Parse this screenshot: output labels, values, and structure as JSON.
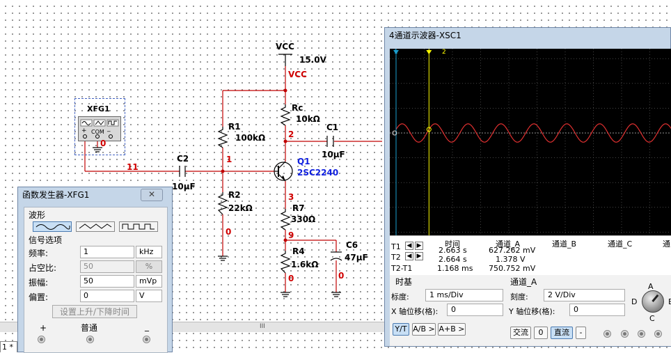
{
  "schematic": {
    "vcc_label": "VCC",
    "vcc_value": "15.0V",
    "vcc_net": "VCC",
    "xfg_label": "XFG1",
    "xfg_com": "COM",
    "xfg_plus": "+",
    "xfg_minus": "_",
    "node_xfg_minus": "0",
    "node_11": "11",
    "node_1": "1",
    "node_2": "2",
    "node_3": "3",
    "node_9": "9",
    "node_0a": "0",
    "node_0b": "0",
    "node_0c": "0",
    "r1_name": "R1",
    "r1_value": "100kΩ",
    "r2_name": "R2",
    "r2_value": "22kΩ",
    "rc_name": "Rc",
    "rc_value": "10kΩ",
    "r7_name": "R7",
    "r7_value": "330Ω",
    "r4_name": "R4",
    "r4_value": "1.6kΩ",
    "c1_name": "C1",
    "c1_value": "10µF",
    "c2_name": "C2",
    "c2_value": "10µF",
    "c6_name": "C6",
    "c6_value": "47µF",
    "q1_name": "Q1",
    "q1_model": "2SC2240",
    "tab_label": "1 *",
    "scroll_glyph": "III"
  },
  "function_generator": {
    "title": "函数发生器-XFG1",
    "close": "✕",
    "waveform_group": "波形",
    "waveforms": [
      "sine-icon",
      "triangle-icon",
      "square-icon"
    ],
    "selected_waveform": "sine",
    "signal_group": "信号选项",
    "rows": [
      {
        "label": "频率:",
        "value": "1",
        "unit": "kHz",
        "disabled": false
      },
      {
        "label": "占空比:",
        "value": "50",
        "unit": "%",
        "disabled": true
      },
      {
        "label": "振幅:",
        "value": "50",
        "unit": "mVp",
        "disabled": false
      },
      {
        "label": "偏置:",
        "value": "0",
        "unit": "V",
        "disabled": false
      }
    ],
    "rise_fall_button": "设置上升/下降时间",
    "terminal_plus": "+",
    "terminal_common": "普通",
    "terminal_minus": "_"
  },
  "oscilloscope": {
    "title": "4通道示波器-XSC1",
    "cursor1_tag": "1",
    "cursor2_tag": "2",
    "headers": [
      "时间",
      "通道_A",
      "通道_B",
      "通道_C",
      "通"
    ],
    "rows": [
      {
        "label": "T1",
        "time": "2.663 s",
        "a": "627.262 mV"
      },
      {
        "label": "T2",
        "time": "2.664 s",
        "a": "1.378 V"
      },
      {
        "label": "T2-T1",
        "time": "1.168 ms",
        "a": "750.752 mV"
      }
    ],
    "timebase_group": "时基",
    "scale_label": "标度:",
    "scale_value": "1 ms/Div",
    "xpos_label": "X 轴位移(格):",
    "xpos_value": "0",
    "channel_group": "通道_A",
    "ch_scale_label": "刻度:",
    "ch_scale_value": "2  V/Div",
    "ypos_label": "Y 轴位移(格):",
    "ypos_value": "0",
    "mode_buttons": [
      "Y/T",
      "A/B >",
      "A+B >"
    ],
    "coupling_buttons": [
      "交流",
      "0",
      "直流",
      "-"
    ],
    "knob_labels": {
      "a": "A",
      "b": "B",
      "c": "C",
      "d": "D"
    },
    "signal_period_ms": 1.168,
    "time_per_div_ms": 1,
    "cursor1_div": 0,
    "cursor2_div": 1.168,
    "amplitude_div": 0.37,
    "colors": {
      "trace": "#e03030",
      "cursor1": "#1a9fd0",
      "cursor2": "#ffff00",
      "grid": "#707070"
    }
  }
}
